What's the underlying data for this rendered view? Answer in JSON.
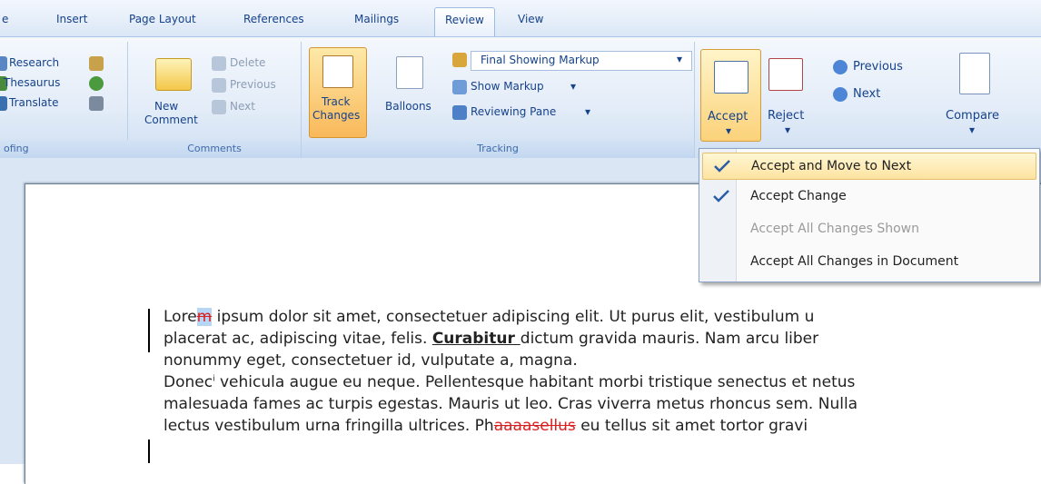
{
  "tabs": [
    "e",
    "Insert",
    "Page Layout",
    "References",
    "Mailings",
    "Review",
    "View"
  ],
  "proofing": {
    "items": [
      "Research",
      "Thesaurus",
      "Translate"
    ],
    "label": "ofing"
  },
  "comments": {
    "new_label": "New",
    "new_label2": "Comment",
    "delete": "Delete",
    "previous": "Previous",
    "next": "Next",
    "label": "Comments"
  },
  "tracking": {
    "track_label": "Track",
    "track_label2": "Changes",
    "balloons": "Balloons",
    "final_showing": "Final Showing Markup",
    "show_markup": "Show Markup",
    "reviewing_pane": "Reviewing Pane",
    "label": "Tracking"
  },
  "changes": {
    "accept": "Accept",
    "reject": "Reject",
    "previous": "Previous",
    "next": "Next",
    "compare": "Compare"
  },
  "accept_menu": [
    {
      "label": "Accept and Move to Next",
      "state": "selected"
    },
    {
      "label": "Accept Change",
      "state": "normal"
    },
    {
      "label": "Accept All Changes Shown",
      "state": "disabled"
    },
    {
      "label": "Accept All Changes in Document",
      "state": "normal"
    }
  ],
  "document": {
    "l1a": "Lore",
    "l1del": "m",
    "l1b": " ipsum dolor sit amet, consectetuer adipiscing elit. Ut purus elit, vestibulum u",
    "l2a": "placerat ac, adipiscing vitae, felis. ",
    "l2ins": "Curabitur ",
    "l2b": "dictum gravida mauris. Nam arcu liber",
    "l3": "nonummy eget, consectetuer id, vulputate a, magna.",
    "l4a": "Donec",
    "l4b": " vehicula augue eu neque. Pellentesque habitant morbi tristique senectus et netus",
    "l5": "malesuada fames ac turpis egestas. Mauris ut leo. Cras viverra metus rhoncus sem. Nulla",
    "l6a": "lectus vestibulum urna fringilla ultrices. Ph",
    "l6del": "aaaasellus",
    "l6b": " eu tellus sit amet tortor gravi"
  }
}
